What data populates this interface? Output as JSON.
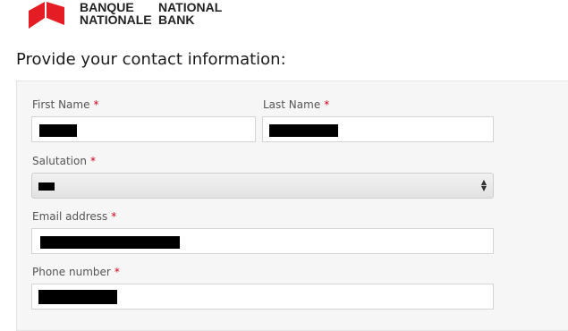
{
  "brand": {
    "name_fr_line1": "BANQUE",
    "name_fr_line2": "NATIONALE",
    "name_en_line1": "NATIONAL",
    "name_en_line2": "BANK",
    "logo_color": "#e41c23"
  },
  "page": {
    "title": "Provide your contact information:"
  },
  "form": {
    "first_name": {
      "label": "First Name",
      "required_marker": "*",
      "value": "[redacted]"
    },
    "last_name": {
      "label": "Last Name",
      "required_marker": "*",
      "value": "[redacted]"
    },
    "salutation": {
      "label": "Salutation",
      "required_marker": "*",
      "value": "[redacted]"
    },
    "email": {
      "label": "Email address",
      "required_marker": "*",
      "value": "[redacted]"
    },
    "phone": {
      "label": "Phone number",
      "required_marker": "*",
      "value": "[redacted]"
    }
  },
  "icons": {
    "logo": "national-bank-logo",
    "select_arrows": "select-arrows-icon"
  },
  "colors": {
    "required": "#d0021b",
    "panel_bg": "#f6f6f6"
  }
}
